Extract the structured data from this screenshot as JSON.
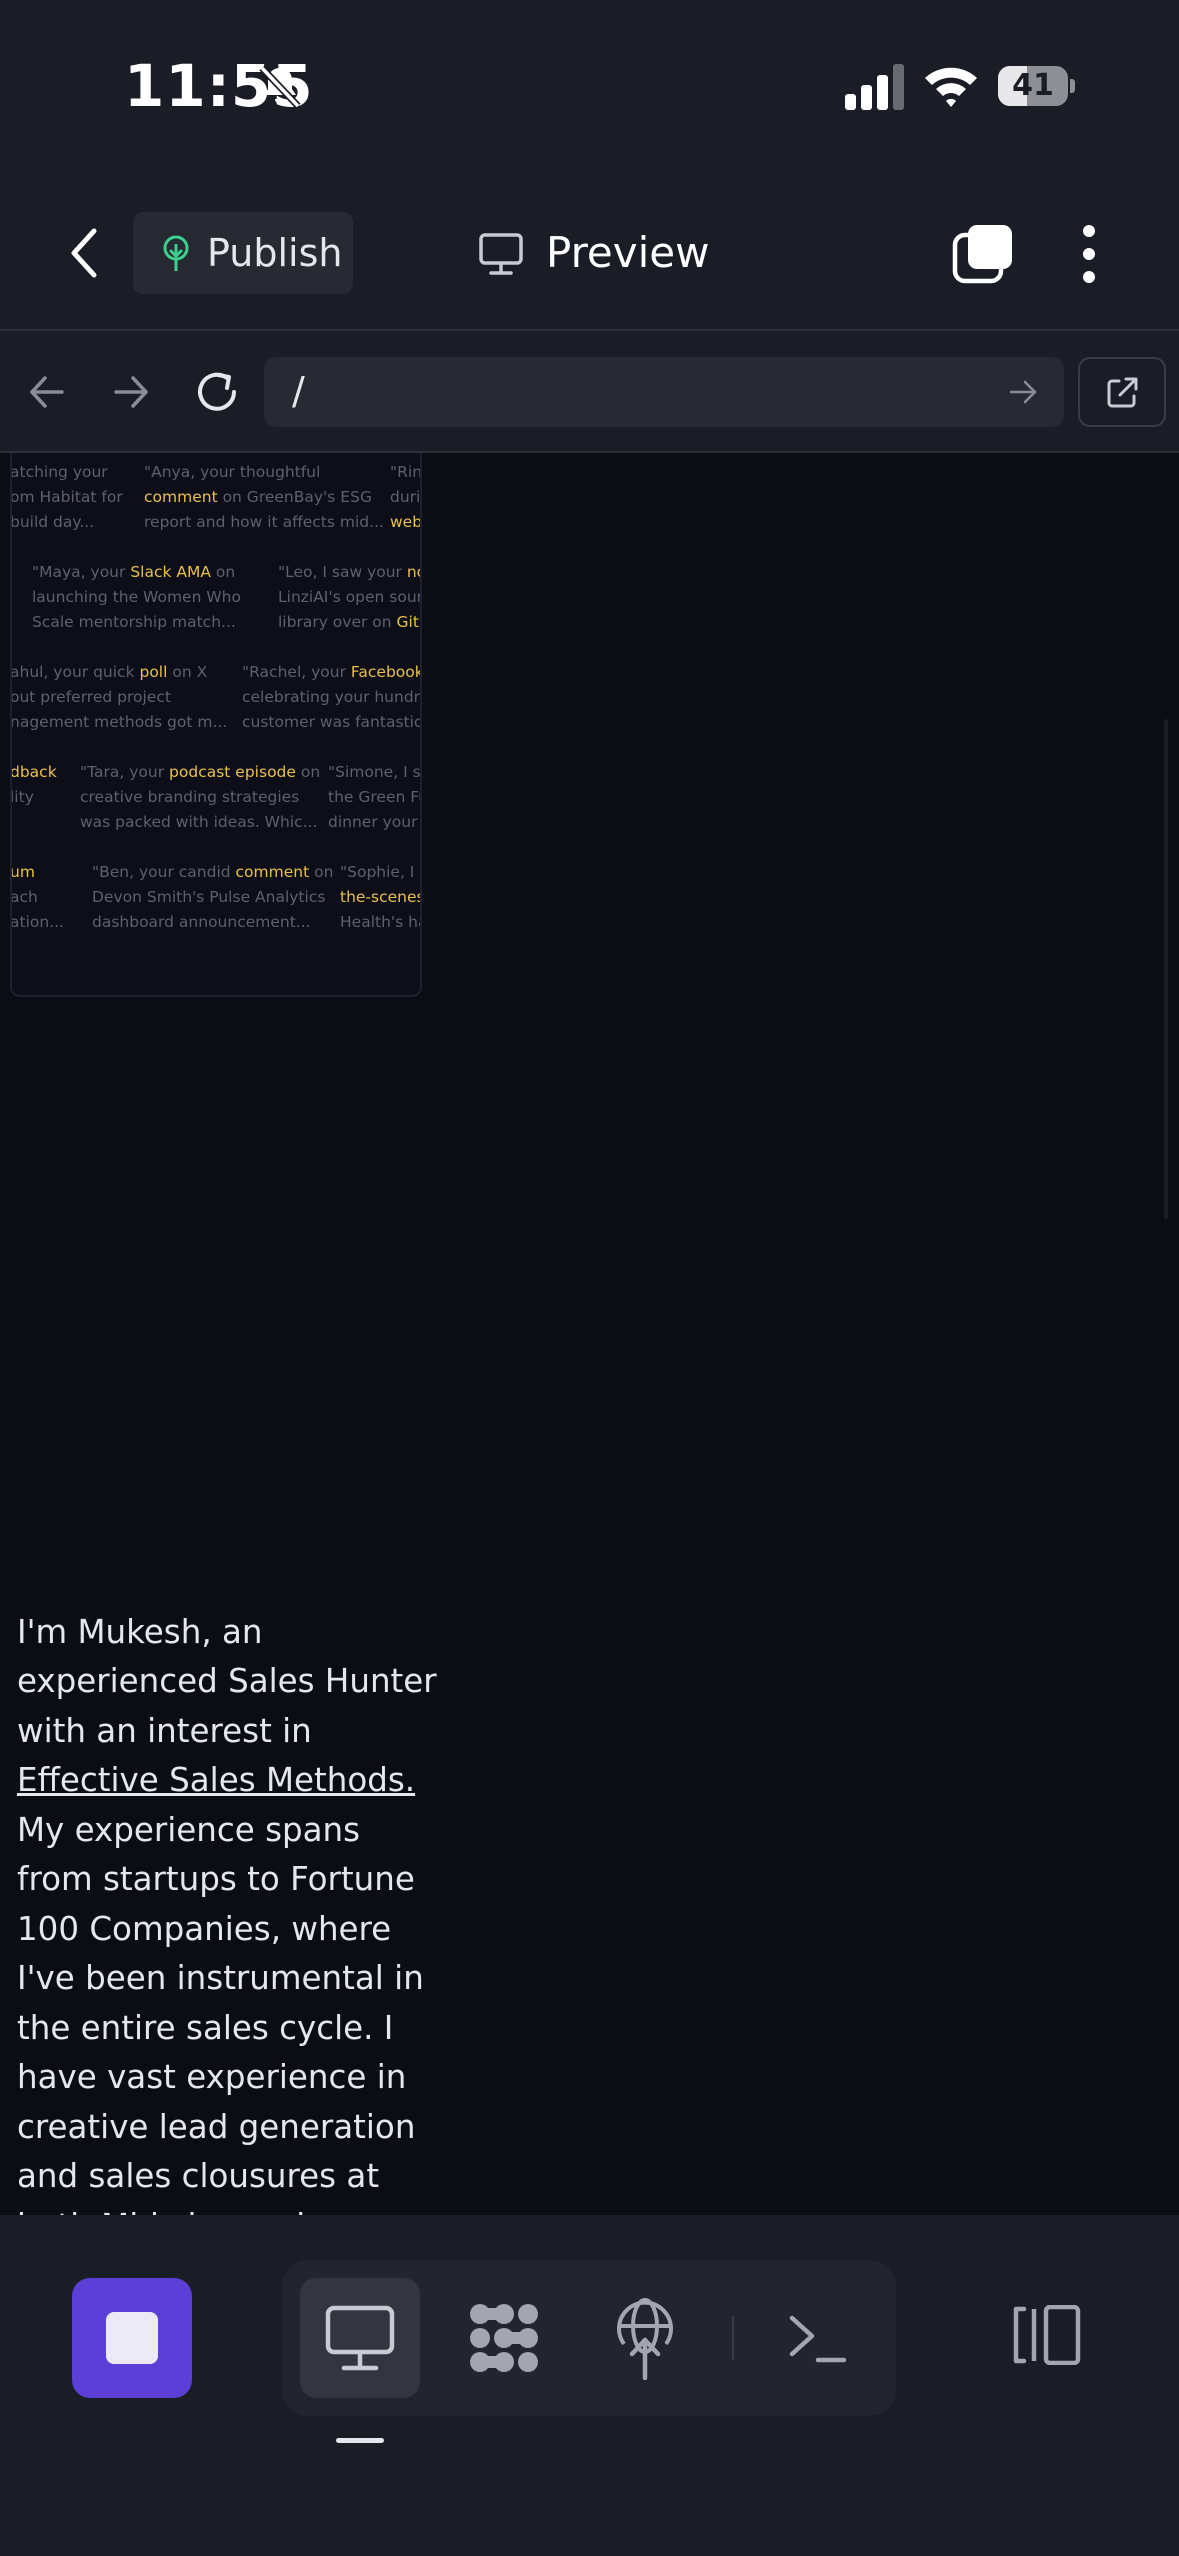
{
  "status_bar": {
    "time": "11:55",
    "battery": "41",
    "battery_level": 41
  },
  "toolbar": {
    "publish_label": "Publish",
    "preview_label": "Preview"
  },
  "browser": {
    "url": "/"
  },
  "testimonials": [
    {
      "pre": "atching your",
      "hl": "",
      "post": ""
    },
    {
      "pre": "om Habitat for",
      "hl": "",
      "post": ""
    },
    {
      "pre": " build day...",
      "hl": "",
      "post": ""
    },
    {
      "pre": "\"Anya, your thoughtful",
      "hl": "",
      "post": ""
    },
    {
      "pre": "",
      "hl": "comment",
      "post": " on GreenBay's ESG"
    },
    {
      "pre": "report and how it affects mid...",
      "hl": "",
      "post": ""
    },
    {
      "pre": "\"Rina",
      "hl": "",
      "post": ""
    },
    {
      "pre": "durin",
      "hl": "",
      "post": ""
    },
    {
      "pre": "",
      "hl": "webi",
      "post": ""
    },
    {
      "pre": "\"Maya, your ",
      "hl": "Slack AMA",
      "post": " on"
    },
    {
      "pre": "launching the Women Who",
      "hl": "",
      "post": ""
    },
    {
      "pre": "Scale mentorship match...",
      "hl": "",
      "post": ""
    },
    {
      "pre": "\"Leo, I saw your ",
      "hl": "note",
      "post": ""
    },
    {
      "pre": "LinziAI's open source",
      "hl": "",
      "post": ""
    },
    {
      "pre": "library over on ",
      "hl": "GitHu",
      "post": ""
    },
    {
      "pre": "ahul, your quick ",
      "hl": "poll",
      "post": " on X"
    },
    {
      "pre": "out preferred project",
      "hl": "",
      "post": ""
    },
    {
      "pre": "nagement methods got m...",
      "hl": "",
      "post": ""
    },
    {
      "pre": "\"Rachel, your ",
      "hl": "Facebook po",
      "post": ""
    },
    {
      "pre": "celebrating your hundred",
      "hl": "",
      "post": ""
    },
    {
      "pre": "customer was fantastic....",
      "hl": "",
      "post": ""
    },
    {
      "pre": "",
      "hl": "dback",
      "post": ""
    },
    {
      "pre": "lity",
      "hl": "",
      "post": ""
    },
    {
      "pre": "\"Tara, your ",
      "hl": "podcast episode",
      "post": " on"
    },
    {
      "pre": "creative branding strategies",
      "hl": "",
      "post": ""
    },
    {
      "pre": "was packed with ideas. Whic...",
      "hl": "",
      "post": ""
    },
    {
      "pre": "\"Simone, I saw",
      "hl": "",
      "post": ""
    },
    {
      "pre": "the Green Fu",
      "hl": "",
      "post": ""
    },
    {
      "pre": "dinner your c",
      "hl": "",
      "post": ""
    },
    {
      "pre": "",
      "hl": "um",
      "post": ""
    },
    {
      "pre": "ach",
      "hl": "",
      "post": ""
    },
    {
      "pre": "ation...",
      "hl": "",
      "post": ""
    },
    {
      "pre": "\"Ben, your candid ",
      "hl": "comment",
      "post": " on"
    },
    {
      "pre": "Devon Smith's Pulse Analytics",
      "hl": "",
      "post": ""
    },
    {
      "pre": "dashboard announcement...",
      "hl": "",
      "post": ""
    },
    {
      "pre": "\"Sophie, I wa",
      "hl": "",
      "post": ""
    },
    {
      "pre": "",
      "hl": "the-scenes",
      "post": ""
    },
    {
      "pre": "Health's hac",
      "hl": "",
      "post": ""
    }
  ],
  "bio": {
    "before": "I'm Mukesh, an experienced Sales Hunter with an interest in ",
    "link": "Effective Sales Methods.",
    "after": " My experience spans from startups to Fortune 100 Companies, where I've been instrumental in the entire sales cycle. I have vast experience in creative lead generation and sales clousures at both Mid-size and Enterprise levels."
  },
  "colors": {
    "accent": "#5b3fd6",
    "highlight": "#e9c14a",
    "publish_icon": "#3ecf8e",
    "background": "#0b0c14",
    "chrome": "#1a1c26"
  },
  "icons": {
    "bell": "bell-slash-icon",
    "signal": "signal-icon",
    "wifi": "wifi-icon",
    "battery": "battery-icon",
    "back": "chevron-left-icon",
    "publish": "tree-icon",
    "preview": "monitor-icon",
    "tabs": "tabs-icon",
    "more": "more-vertical-icon",
    "nav_back": "arrow-left-icon",
    "nav_forward": "arrow-right-icon",
    "reload": "reload-icon",
    "go": "arrow-right-icon",
    "open": "external-link-icon",
    "stop": "stop-icon",
    "webview": "monitor-icon",
    "workflows": "workflow-icon",
    "deploy": "globe-upload-icon",
    "shell": "terminal-icon",
    "panel": "panel-icon"
  }
}
